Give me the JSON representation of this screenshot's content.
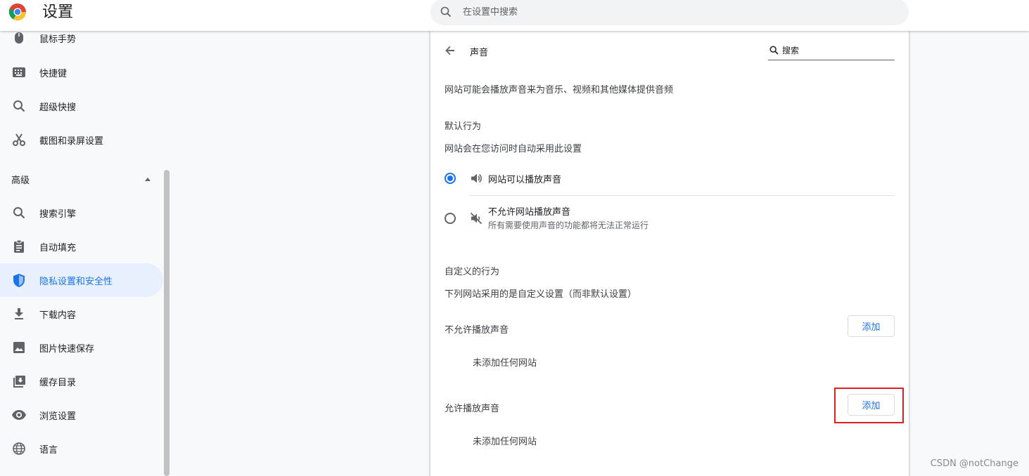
{
  "header": {
    "title": "设置",
    "search_placeholder": "在设置中搜索"
  },
  "sidebar": {
    "items_top": [
      {
        "label": "鼠标手势",
        "icon": "mouse-icon"
      },
      {
        "label": "快捷键",
        "icon": "keyboard-icon"
      },
      {
        "label": "超级快搜",
        "icon": "search-icon"
      },
      {
        "label": "截图和录屏设置",
        "icon": "scissors-icon"
      }
    ],
    "section_label": "高级",
    "items_advanced": [
      {
        "label": "搜索引擎",
        "icon": "search-icon"
      },
      {
        "label": "自动填充",
        "icon": "clipboard-icon"
      },
      {
        "label": "隐私设置和安全性",
        "icon": "shield-icon",
        "active": true
      },
      {
        "label": "下载内容",
        "icon": "download-icon"
      },
      {
        "label": "图片快速保存",
        "icon": "image-icon"
      },
      {
        "label": "缓存目录",
        "icon": "cache-folder-icon"
      },
      {
        "label": "浏览设置",
        "icon": "eye-icon"
      },
      {
        "label": "语言",
        "icon": "globe-icon"
      }
    ]
  },
  "page": {
    "title": "声音",
    "search_placeholder": "搜索",
    "description": "网站可能会播放声音来为音乐、视频和其他媒体提供音频",
    "default_heading": "默认行为",
    "default_sub": "网站会在您访问时自动采用此设置",
    "option_allow": "网站可以播放声音",
    "option_block": "不允许网站播放声音",
    "option_block_desc": "所有需要使用声音的功能都将无法正常运行",
    "selected_option": "allow",
    "custom_heading": "自定义的行为",
    "custom_sub": "下列网站采用的是自定义设置（而非默认设置）",
    "block_list_title": "不允许播放声音",
    "block_list_empty": "未添加任何网站",
    "allow_list_title": "允许播放声音",
    "allow_list_empty": "未添加任何网站",
    "add_label": "添加"
  },
  "colors": {
    "accent": "#1a73e8",
    "highlight_box": "#e02020"
  },
  "watermark": "CSDN @notChange"
}
